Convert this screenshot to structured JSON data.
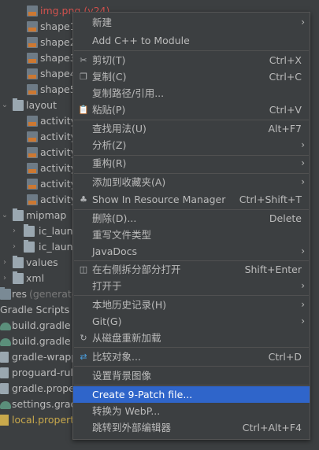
{
  "tree": {
    "items": [
      {
        "label": "img.png (v24)",
        "color": "red"
      },
      {
        "label": "shape1"
      },
      {
        "label": "shape2"
      },
      {
        "label": "shape3"
      },
      {
        "label": "shape4"
      },
      {
        "label": "shape5"
      },
      {
        "label": "layout"
      },
      {
        "label": "activity_"
      },
      {
        "label": "activity_"
      },
      {
        "label": "activity_"
      },
      {
        "label": "activity_"
      },
      {
        "label": "activity_"
      },
      {
        "label": "activity_"
      },
      {
        "label": "mipmap"
      },
      {
        "label": "ic_launc"
      },
      {
        "label": "ic_launc"
      },
      {
        "label": "values"
      },
      {
        "label": "xml"
      },
      {
        "label": "res",
        "suffix": "(generated)"
      },
      {
        "label": "Gradle Scripts"
      },
      {
        "label": "build.gradle ("
      },
      {
        "label": "build.gradle ("
      },
      {
        "label": "gradle-wrapp"
      },
      {
        "label": "proguard-rule"
      },
      {
        "label": "gradle.prope"
      },
      {
        "label": "settings.gradl"
      },
      {
        "label": "local.properti"
      }
    ]
  },
  "menu": {
    "items": [
      {
        "label": "新建",
        "submenu": true
      },
      {
        "label": "Add C++ to Module"
      },
      {
        "label": "剪切(T)",
        "shortcut": "Ctrl+X",
        "icon": "cut-icon"
      },
      {
        "label": "复制(C)",
        "shortcut": "Ctrl+C",
        "icon": "copy-icon"
      },
      {
        "label": "复制路径/引用..."
      },
      {
        "label": "粘贴(P)",
        "shortcut": "Ctrl+V",
        "icon": "paste-icon"
      },
      {
        "label": "查找用法(U)",
        "shortcut": "Alt+F7"
      },
      {
        "label": "分析(Z)",
        "submenu": true
      },
      {
        "label": "重构(R)",
        "submenu": true
      },
      {
        "label": "添加到收藏夹(A)",
        "submenu": true
      },
      {
        "label": "Show In Resource Manager",
        "shortcut": "Ctrl+Shift+T",
        "icon": "resource-manager-icon"
      },
      {
        "label": "删除(D)...",
        "shortcut": "Delete"
      },
      {
        "label": "重写文件类型"
      },
      {
        "label": "JavaDocs",
        "submenu": true
      },
      {
        "label": "在右侧拆分部分打开",
        "shortcut": "Shift+Enter",
        "icon": "split-icon"
      },
      {
        "label": "打开于",
        "submenu": true
      },
      {
        "label": "本地历史记录(H)",
        "submenu": true
      },
      {
        "label": "Git(G)",
        "submenu": true
      },
      {
        "label": "从磁盘重新加载",
        "icon": "reload-icon"
      },
      {
        "label": "比较对象...",
        "shortcut": "Ctrl+D",
        "icon": "compare-icon"
      },
      {
        "label": "设置背景图像"
      },
      {
        "label": "Create 9-Patch file..."
      },
      {
        "label": "转换为 WebP..."
      },
      {
        "label": "跳转到外部编辑器",
        "shortcut": "Ctrl+Alt+F4"
      }
    ],
    "selected_label": "Create 9-Patch file..."
  },
  "colors": {
    "background": "#3c3f41",
    "selection": "#2f65ca",
    "text": "#bbbbbb",
    "error_text": "#d2524e",
    "warning_text": "#c9a94c"
  }
}
